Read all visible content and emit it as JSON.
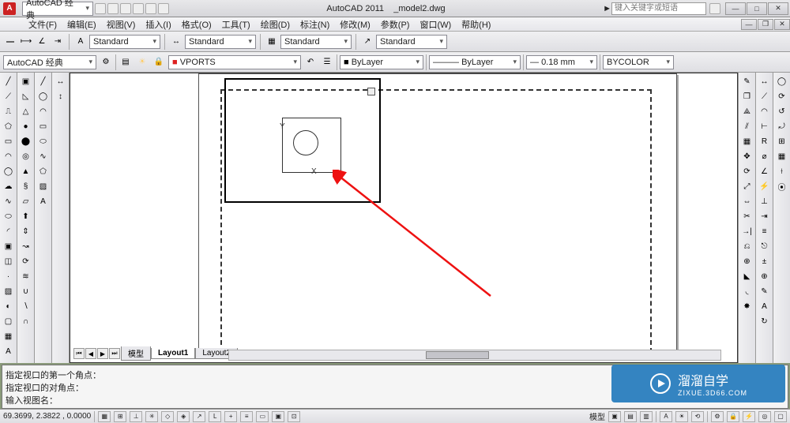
{
  "title": {
    "app": "AutoCAD 2011",
    "file": "_model2.dwg",
    "search_placeholder": "键入关键字或短语",
    "workspace_label": "AutoCAD 经典"
  },
  "menu": {
    "items": [
      "文件(F)",
      "编辑(E)",
      "视图(V)",
      "插入(I)",
      "格式(O)",
      "工具(T)",
      "绘图(D)",
      "标注(N)",
      "修改(M)",
      "参数(P)",
      "窗口(W)",
      "帮助(H)"
    ]
  },
  "styles": {
    "s1": "Standard",
    "s2": "Standard",
    "s3": "Standard",
    "s4": "Standard"
  },
  "layers": {
    "name": "VPORTS",
    "current": "ByLayer",
    "ltype": "ByLayer",
    "lweight": "0.18 mm",
    "color": "BYCOLOR"
  },
  "tabs": {
    "model": "模型",
    "l1": "Layout1",
    "l2": "Layout2"
  },
  "cmd": {
    "l1": "指定视口的第一个角点：",
    "l2": "指定视口的对角点：",
    "l3": "输入视图名："
  },
  "status": {
    "coords": "69.3699, 2.3822 , 0.0000",
    "mid": "模型"
  },
  "ucs": {
    "x": "X",
    "y": "Y"
  },
  "wm": {
    "main": "溜溜自学",
    "sub": "ZIXUE.3D66.COM"
  }
}
